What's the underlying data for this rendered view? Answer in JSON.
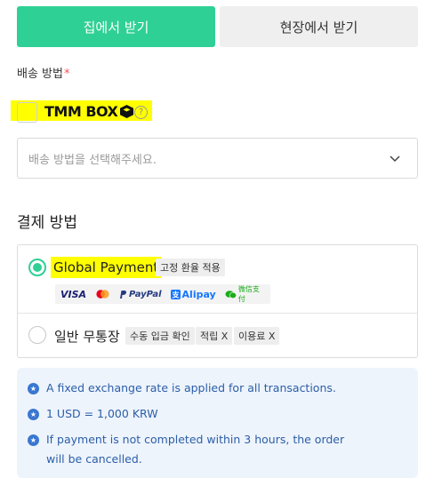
{
  "tabs": [
    {
      "label": "집에서 받기",
      "active": true
    },
    {
      "label": "현장에서 받기",
      "active": false
    }
  ],
  "shipping": {
    "label": "배송 방법",
    "required_mark": "*",
    "option_logo_text": "TMM BOX",
    "select_placeholder": "배송 방법을 선택해주세요."
  },
  "payment": {
    "title": "결제 방법",
    "methods": [
      {
        "label": "Global Payment",
        "selected": true,
        "badges": [
          "고정 환율 적용"
        ],
        "logos": [
          "VISA",
          "PayPal",
          "Alipay",
          "微信支付"
        ]
      },
      {
        "label": "일반 무통장",
        "selected": false,
        "badges": [
          "수동 입금 확인",
          "적립 X",
          "이용료 X"
        ]
      }
    ]
  },
  "info": {
    "items": [
      "A fixed exchange rate is applied for all transactions.",
      "1 USD = 1,000 KRW",
      "If payment is not completed within 3 hours, the order will be cancelled."
    ]
  },
  "colors": {
    "accent": "#2fd095",
    "highlight": "#ffff00",
    "info_bg": "#eef4fc",
    "info_text": "#2b5ea8"
  }
}
